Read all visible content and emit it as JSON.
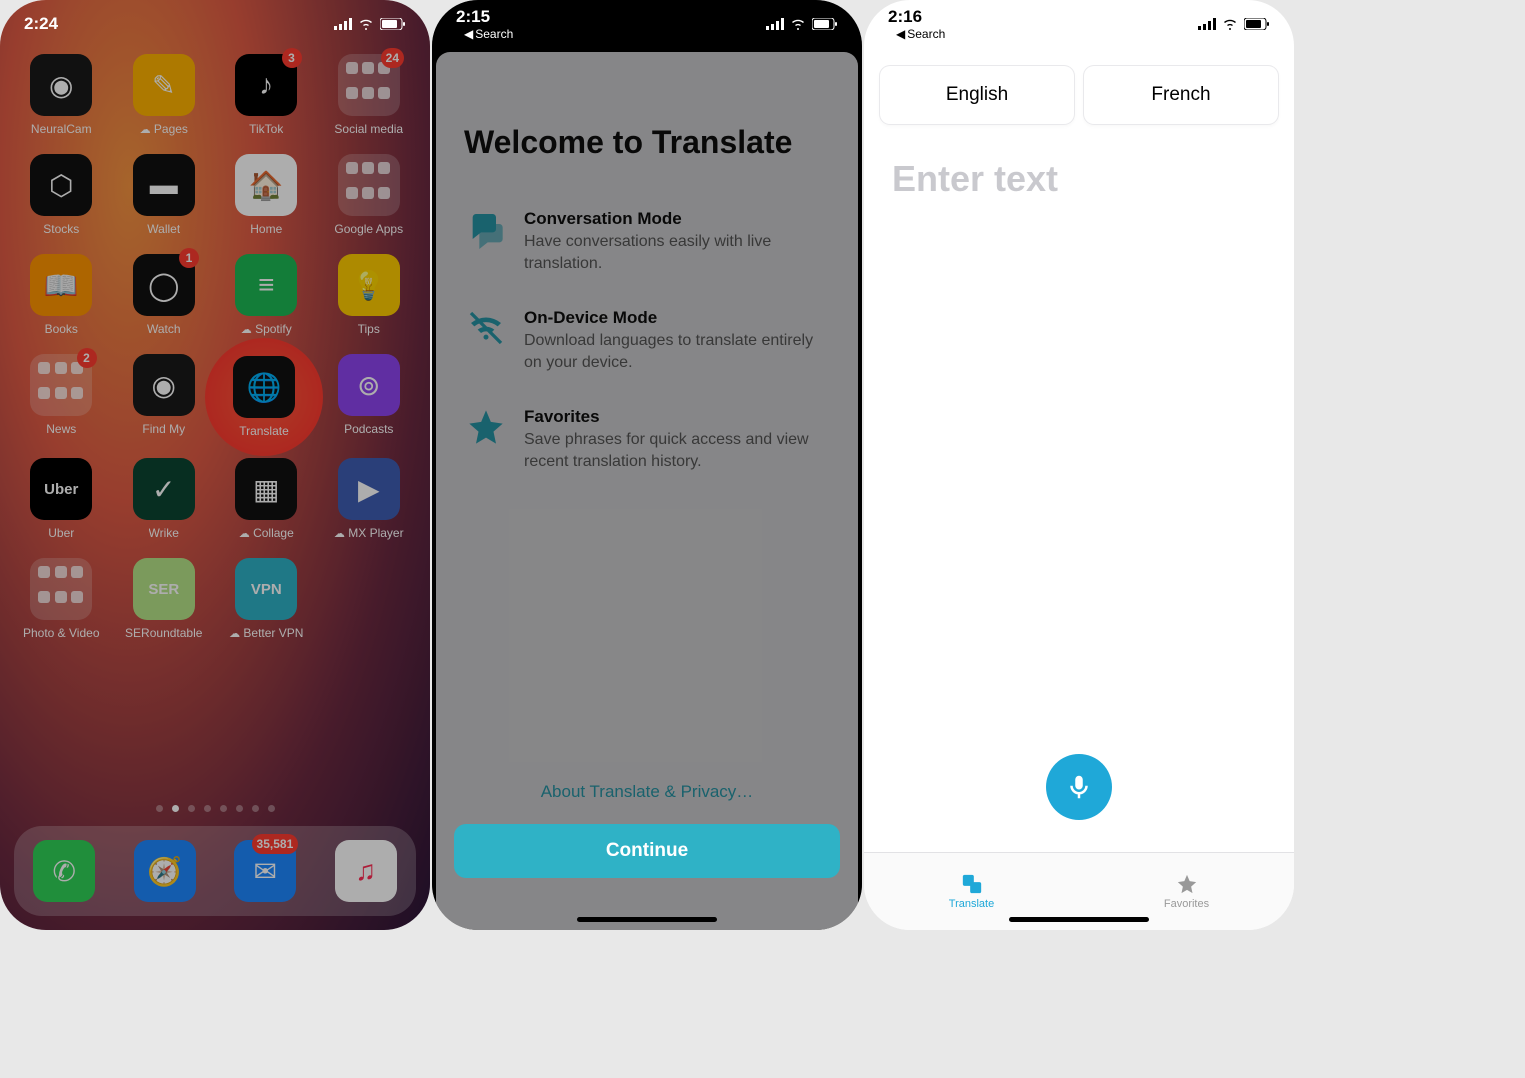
{
  "screen1": {
    "status": {
      "time": "2:24"
    },
    "apps": [
      {
        "label": "NeuralCam",
        "bg": "#1a1a1a",
        "glyph": "◉"
      },
      {
        "label": "Pages",
        "bg": "#ffb300",
        "glyph": "✎",
        "cloud": true
      },
      {
        "label": "TikTok",
        "bg": "#000",
        "glyph": "♪",
        "badge": "3"
      },
      {
        "label": "Social media",
        "folder": true,
        "badge": "24"
      },
      {
        "label": "Stocks",
        "bg": "#111",
        "glyph": "⬡"
      },
      {
        "label": "Wallet",
        "bg": "#111",
        "glyph": "▬"
      },
      {
        "label": "Home",
        "bg": "#fff",
        "glyph": "🏠"
      },
      {
        "label": "Google Apps",
        "folder": true
      },
      {
        "label": "Books",
        "bg": "#ff9500",
        "glyph": "📖"
      },
      {
        "label": "Watch",
        "bg": "#111",
        "glyph": "◯",
        "badge": "1"
      },
      {
        "label": "Spotify",
        "bg": "#1db954",
        "glyph": "≡",
        "cloud": true
      },
      {
        "label": "Tips",
        "bg": "#ffcc00",
        "glyph": "💡"
      },
      {
        "label": "News",
        "folder": true,
        "badge": "2"
      },
      {
        "label": "Find My",
        "bg": "#1a1a1a",
        "glyph": "◉",
        "accent": "#30d158"
      },
      {
        "label": "Translate",
        "bg": "#111",
        "glyph": "🌐",
        "highlight": true
      },
      {
        "label": "Podcasts",
        "bg": "#8e44ef",
        "glyph": "⊚"
      },
      {
        "label": "Uber",
        "bg": "#000",
        "glyph": "Uber",
        "text": true
      },
      {
        "label": "Wrike",
        "bg": "#0b4432",
        "glyph": "✓"
      },
      {
        "label": "Collage",
        "bg": "#111",
        "glyph": "▦",
        "cloud": true
      },
      {
        "label": "MX Player",
        "bg": "#3f5db3",
        "glyph": "▶",
        "cloud": true
      },
      {
        "label": "Photo & Video",
        "folder": true
      },
      {
        "label": "SERoundtable",
        "bg": "#b6e388",
        "glyph": "SER",
        "text": true
      },
      {
        "label": "Better VPN",
        "bg": "#2fb2c6",
        "glyph": "VPN",
        "text": true,
        "cloud": true
      }
    ],
    "dock": [
      {
        "name": "phone",
        "bg": "#30d158",
        "glyph": "✆"
      },
      {
        "name": "safari",
        "bg": "#1e88ff",
        "glyph": "🧭"
      },
      {
        "name": "mail",
        "bg": "#1e88ff",
        "glyph": "✉",
        "badge": "35,581"
      },
      {
        "name": "music",
        "bg": "#fff",
        "glyph": "♫"
      }
    ],
    "page_dots": 8,
    "active_dot": 1
  },
  "screen2": {
    "status": {
      "time": "2:15",
      "back": "Search"
    },
    "title": "Welcome to Translate",
    "features": [
      {
        "icon": "chat",
        "title": "Conversation Mode",
        "desc": "Have conversations easily with live translation."
      },
      {
        "icon": "wifi-off",
        "title": "On-Device Mode",
        "desc": "Download languages to translate entirely on your device."
      },
      {
        "icon": "star",
        "title": "Favorites",
        "desc": "Save phrases for quick access and view recent translation history."
      }
    ],
    "privacy_link": "About Translate & Privacy…",
    "continue": "Continue"
  },
  "screen3": {
    "status": {
      "time": "2:16",
      "back": "Search"
    },
    "lang_from": "English",
    "lang_to": "French",
    "placeholder": "Enter text",
    "tabs": {
      "translate": "Translate",
      "favorites": "Favorites"
    }
  }
}
